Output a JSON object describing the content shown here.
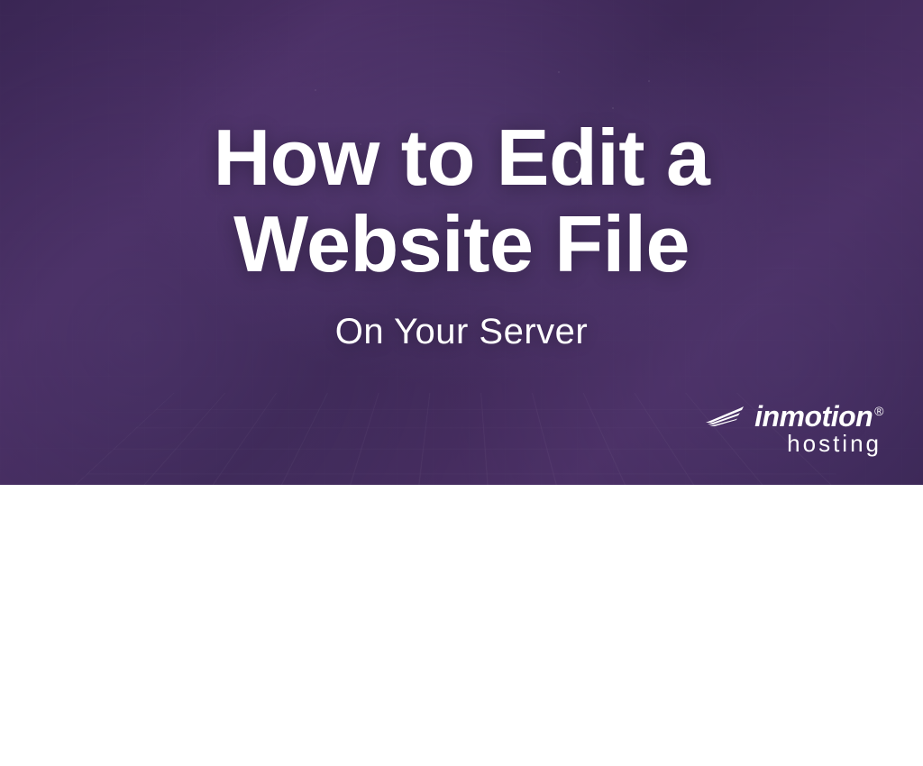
{
  "hero": {
    "title_line1": "How to Edit a",
    "title_line2": "Website File",
    "subtitle": "On Your Server"
  },
  "logo": {
    "brand": "inmotion",
    "registered": "®",
    "sub": "hosting"
  },
  "colors": {
    "overlay": "#4a2f64",
    "text": "#ffffff"
  }
}
